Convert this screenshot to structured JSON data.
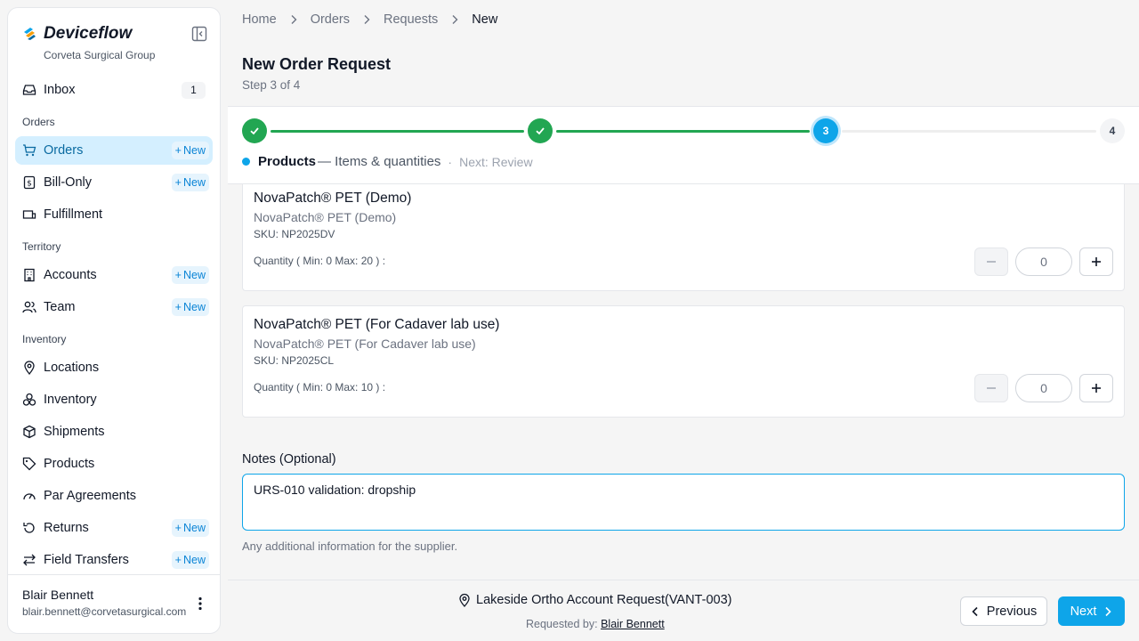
{
  "brand": {
    "name": "Deviceflow",
    "org": "Corveta Surgical Group"
  },
  "sidebar": {
    "inbox": {
      "label": "Inbox",
      "count": "1"
    },
    "sections": {
      "orders": "Orders",
      "territory": "Territory",
      "inventory": "Inventory"
    },
    "items": {
      "orders": {
        "label": "Orders",
        "new": "New"
      },
      "bill_only": {
        "label": "Bill-Only",
        "new": "New"
      },
      "fulfillment": {
        "label": "Fulfillment"
      },
      "accounts": {
        "label": "Accounts",
        "new": "New"
      },
      "team": {
        "label": "Team",
        "new": "New"
      },
      "locations": {
        "label": "Locations"
      },
      "inventory": {
        "label": "Inventory"
      },
      "shipments": {
        "label": "Shipments"
      },
      "products": {
        "label": "Products"
      },
      "par_agreements": {
        "label": "Par Agreements"
      },
      "returns": {
        "label": "Returns",
        "new": "New"
      },
      "field_transfers": {
        "label": "Field Transfers",
        "new": "New"
      }
    },
    "user": {
      "name": "Blair Bennett",
      "email": "blair.bennett@corvetasurgical.com"
    }
  },
  "breadcrumb": [
    "Home",
    "Orders",
    "Requests",
    "New"
  ],
  "page": {
    "title": "New Order Request",
    "step": "Step 3 of 4"
  },
  "stepper": {
    "current": 3,
    "total": 4,
    "step3_label": "3",
    "step4_label": "4",
    "caption": {
      "name": "Products",
      "desc": "— Items & quantities",
      "sep": "·",
      "next": "Next: Review"
    }
  },
  "products": [
    {
      "name": "NovaPatch® PET (Demo)",
      "sub": "NovaPatch® PET (Demo)",
      "sku": "SKU: NP2025DV",
      "qty_label": "Quantity ( Min: 0 Max: 20 ) :",
      "qty": "0"
    },
    {
      "name": "NovaPatch® PET (For Cadaver lab use)",
      "sub": "NovaPatch® PET (For Cadaver lab use)",
      "sku": "SKU: NP2025CL",
      "qty_label": "Quantity ( Min: 0 Max: 10 ) :",
      "qty": "0"
    }
  ],
  "notes": {
    "label": "Notes (Optional)",
    "value": "URS-010 validation: dropship",
    "help": "Any additional information for the supplier."
  },
  "footer": {
    "account": "Lakeside Ortho Account Request(VANT-003)",
    "requested_by_label": "Requested by:",
    "requested_by": "Blair Bennett",
    "prev": "Previous",
    "next": "Next"
  },
  "colors": {
    "accent": "#0ea5e9",
    "success": "#22a652",
    "active_bg": "#d4efff"
  }
}
